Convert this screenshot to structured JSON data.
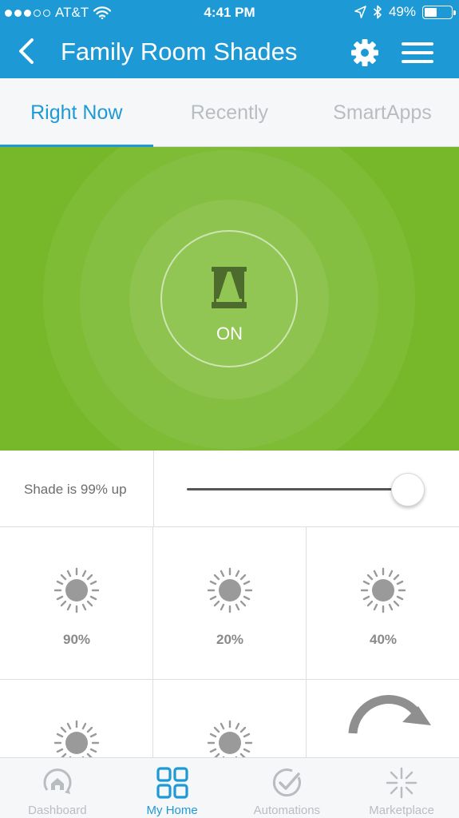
{
  "status_bar": {
    "carrier": "AT&T",
    "time": "4:41 PM",
    "battery": "49%",
    "battery_level": 0.49,
    "signal_bars": 3,
    "signal_total": 5
  },
  "nav": {
    "title": "Family Room Shades",
    "back_icon": "chevron-left-icon",
    "settings_icon": "gear-icon",
    "menu_icon": "hamburger-menu-icon"
  },
  "tabs": [
    {
      "label": "Right Now",
      "active": true
    },
    {
      "label": "Recently",
      "active": false
    },
    {
      "label": "SmartApps",
      "active": false
    }
  ],
  "hero": {
    "state": "ON",
    "icon": "window-shade-icon",
    "color": "#76b82a"
  },
  "shade_slider": {
    "label": "Shade is 99% up",
    "value": 99
  },
  "presets": [
    {
      "label": "90%",
      "icon": "sun-icon"
    },
    {
      "label": "20%",
      "icon": "sun-icon"
    },
    {
      "label": "40%",
      "icon": "sun-icon"
    },
    {
      "label": "",
      "icon": "sun-icon"
    },
    {
      "label": "",
      "icon": "sun-icon"
    },
    {
      "label": "",
      "icon": "refresh-icon"
    }
  ],
  "bottom_tabs": [
    {
      "label": "Dashboard",
      "icon": "dashboard-home-icon",
      "active": false
    },
    {
      "label": "My Home",
      "icon": "grid-icon",
      "active": true
    },
    {
      "label": "Automations",
      "icon": "check-circle-icon",
      "active": false
    },
    {
      "label": "Marketplace",
      "icon": "sparkle-icon",
      "active": false
    }
  ],
  "colors": {
    "accent": "#1d9ad6",
    "hero_green": "#76b82a",
    "inactive": "#b9bdc2",
    "icon_gray": "#9a9a9a"
  }
}
